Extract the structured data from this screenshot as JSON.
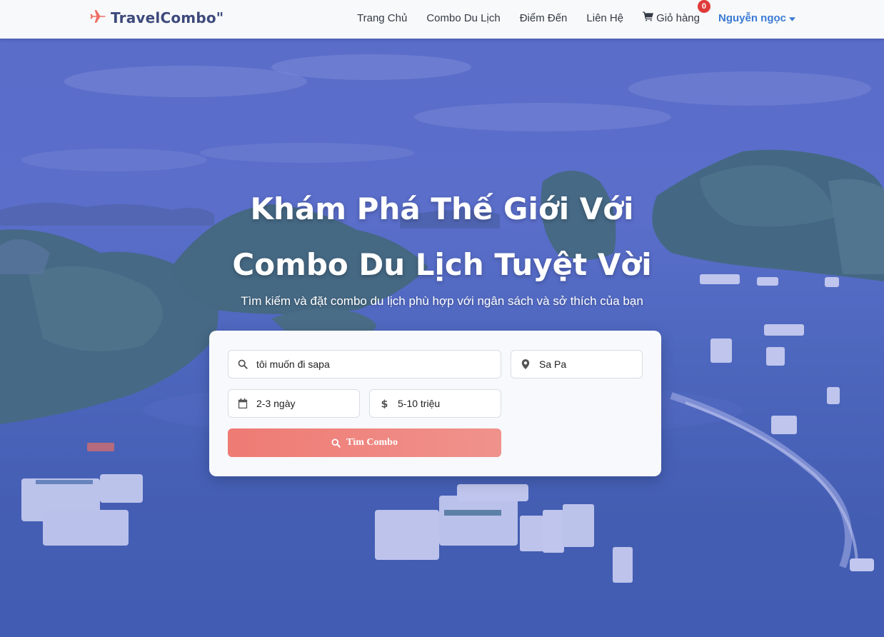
{
  "brand": {
    "name": "TravelCombo\"",
    "icon": "plane-icon",
    "icon_color": "#ee6e66"
  },
  "nav": {
    "items": [
      {
        "label": "Trang Chủ"
      },
      {
        "label": "Combo Du Lịch"
      },
      {
        "label": "Điểm Đến"
      },
      {
        "label": "Liên Hệ"
      }
    ],
    "cart": {
      "label": "Giỏ hàng",
      "count": "0",
      "icon": "cart-icon"
    },
    "user": {
      "name": "Nguyễn ngọc",
      "icon": "caret-down-icon",
      "color": "#3a7bd5"
    }
  },
  "hero": {
    "title_line1": "Khám Phá Thế Giới Với",
    "title_line2": "Combo Du Lịch Tuyệt Vời",
    "subtitle": "Tìm kiếm và đặt combo du lịch phù hợp với ngân sách và sở thích của bạn"
  },
  "search": {
    "query": {
      "value": "tôi muốn đi sapa",
      "icon": "search-icon"
    },
    "location": {
      "value": "Sa Pa",
      "icon": "location-pin-icon"
    },
    "duration": {
      "value": "2-3 ngày",
      "icon": "calendar-icon"
    },
    "budget": {
      "value": "5-10 triệu",
      "icon": "dollar-icon"
    },
    "button": {
      "label": "Tìm Combo",
      "icon": "search-icon",
      "color": "#ee7b74"
    }
  }
}
